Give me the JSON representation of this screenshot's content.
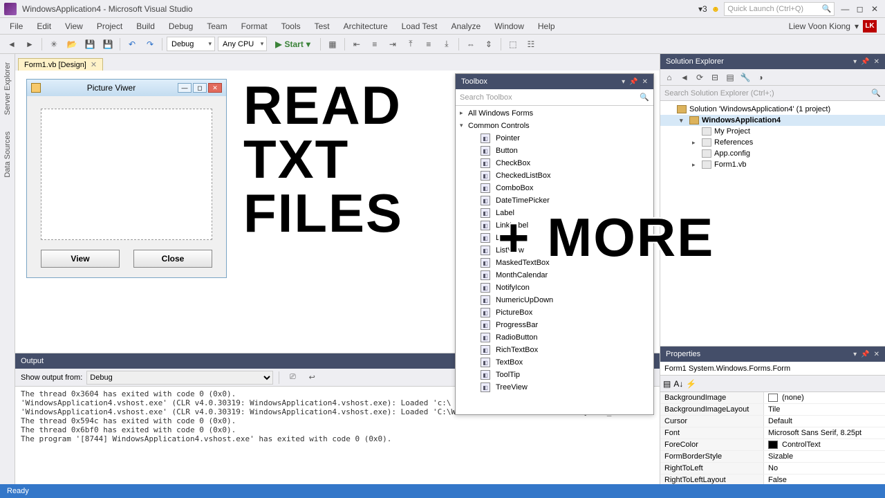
{
  "title": "WindowsApplication4 - Microsoft Visual Studio",
  "notif_count": "3",
  "quick_launch_placeholder": "Quick Launch (Ctrl+Q)",
  "user_name": "Liew Voon Kiong",
  "user_initials": "LK",
  "menu": [
    "File",
    "Edit",
    "View",
    "Project",
    "Build",
    "Debug",
    "Team",
    "Format",
    "Tools",
    "Test",
    "Architecture",
    "Load Test",
    "Analyze",
    "Window",
    "Help"
  ],
  "toolbar": {
    "config": "Debug",
    "platform": "Any CPU",
    "start": "Start"
  },
  "left_tabs": [
    "Server Explorer",
    "Data Sources"
  ],
  "doc_tab": "Form1.vb [Design]",
  "form": {
    "title": "Picture Viwer",
    "btn_view": "View",
    "btn_close": "Close"
  },
  "overlay": {
    "l1": "READ",
    "l2": "TXT",
    "l3": "FILES",
    "plus": "+ MORE"
  },
  "toolbox": {
    "title": "Toolbox",
    "search": "Search Toolbox",
    "cat1": "All Windows Forms",
    "cat2": "Common Controls",
    "items": [
      "Pointer",
      "Button",
      "CheckBox",
      "CheckedListBox",
      "ComboBox",
      "DateTimePicker",
      "Label",
      "LinkLabel",
      "ListBox",
      "ListView",
      "MaskedTextBox",
      "MonthCalendar",
      "NotifyIcon",
      "NumericUpDown",
      "PictureBox",
      "ProgressBar",
      "RadioButton",
      "RichTextBox",
      "TextBox",
      "ToolTip",
      "TreeView"
    ]
  },
  "solution": {
    "title": "Solution Explorer",
    "search": "Search Solution Explorer (Ctrl+;)",
    "root": "Solution 'WindowsApplication4' (1 project)",
    "project": "WindowsApplication4",
    "nodes": [
      "My Project",
      "References",
      "App.config",
      "Form1.vb"
    ]
  },
  "properties": {
    "title": "Properties",
    "object": "Form1  System.Windows.Forms.Form",
    "rows": [
      {
        "name": "BackgroundImage",
        "val": "(none)",
        "swatch": "#fff"
      },
      {
        "name": "BackgroundImageLayout",
        "val": "Tile"
      },
      {
        "name": "Cursor",
        "val": "Default"
      },
      {
        "name": "Font",
        "val": "Microsoft Sans Serif, 8.25pt"
      },
      {
        "name": "ForeColor",
        "val": "ControlText",
        "swatch": "#000"
      },
      {
        "name": "FormBorderStyle",
        "val": "Sizable"
      },
      {
        "name": "RightToLeft",
        "val": "No"
      },
      {
        "name": "RightToLeftLayout",
        "val": "False"
      }
    ]
  },
  "output": {
    "title": "Output",
    "label": "Show output from:",
    "source": "Debug",
    "lines": [
      "The thread 0x3604 has exited with code 0 (0x0).",
      "'WindowsApplication4.vshost.exe' (CLR v4.0.30319: WindowsApplication4.vshost.exe): Loaded 'c:\\",
      "'WindowsApplication4.vshost.exe' (CLR v4.0.30319: WindowsApplication4.vshost.exe): Loaded 'C:\\Windows\\Microsoft.Net\\assembly\\GAC_MSIL\\S",
      "The thread 0x594c has exited with code 0 (0x0).",
      "The thread 0x6bf0 has exited with code 0 (0x0).",
      "The program '[8744] WindowsApplication4.vshost.exe' has exited with code 0 (0x0)."
    ]
  },
  "status": "Ready"
}
